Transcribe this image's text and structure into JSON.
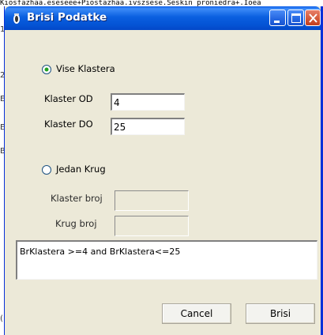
{
  "window": {
    "title": "Brisi Podatke"
  },
  "background_text": "Kiosfazhaa.eseseee+Piostazhaa.ivszsese.Seskin proniedra+.Ioea",
  "options": {
    "more_clusters_label": "Vise Klastera",
    "more_clusters_selected": true,
    "one_circle_label": "Jedan Krug",
    "one_circle_selected": false
  },
  "fields": {
    "cluster_from_label": "Klaster OD",
    "cluster_from_value": "4",
    "cluster_to_label": "Klaster DO",
    "cluster_to_value": "25",
    "cluster_number_label": "Klaster broj",
    "cluster_number_value": "",
    "circle_number_label": "Krug broj",
    "circle_number_value": ""
  },
  "query_text": "BrKlastera >=4 and BrKlastera<=25",
  "buttons": {
    "cancel": "Cancel",
    "delete": "Brisi"
  },
  "colors": {
    "titlebar": "#0a5fe0",
    "dialog_bg": "#ece9d8",
    "close_button": "#d45a3a"
  }
}
